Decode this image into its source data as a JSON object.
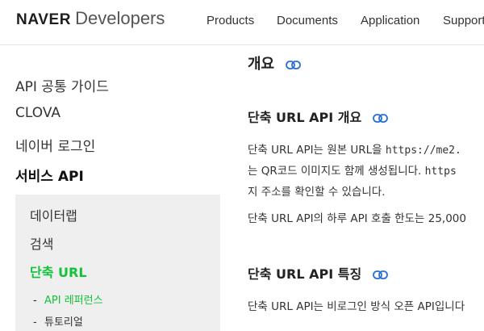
{
  "header": {
    "logo_brand": "NAVER",
    "logo_sub": "Developers",
    "nav": [
      "Products",
      "Documents",
      "Application",
      "Support"
    ]
  },
  "sidebar": {
    "items": [
      "API 공통 가이드",
      "CLOVA",
      "네이버 로그인",
      "서비스 API"
    ],
    "sub_items": [
      "데이터랩",
      "검색",
      "단축 URL"
    ],
    "subsub_items": [
      "API 레퍼런스",
      "튜토리얼"
    ],
    "dash": "-"
  },
  "content": {
    "h_overview": "개요",
    "h_api_overview": "단축 URL API 개요",
    "p1_line1_a": "단축 URL API는 원본 URL을 ",
    "p1_line1_code": "https://me2.",
    "p1_line2_a": "는 QR코드 이미지도 함께 생성됩니다. ",
    "p1_line2_code": "https",
    "p1_line3": "지 주소를 확인할 수 있습니다.",
    "p2": "단축 URL API의 하루 API 호출 한도는 25,000",
    "h_features": "단축 URL API 특징",
    "p3": "단축 URL API는 비로그인 방식 오픈 API입니다",
    "accent_color": "#13c23b",
    "link_icon_color": "#2a6fd6",
    "link_icon": "link-icon"
  }
}
